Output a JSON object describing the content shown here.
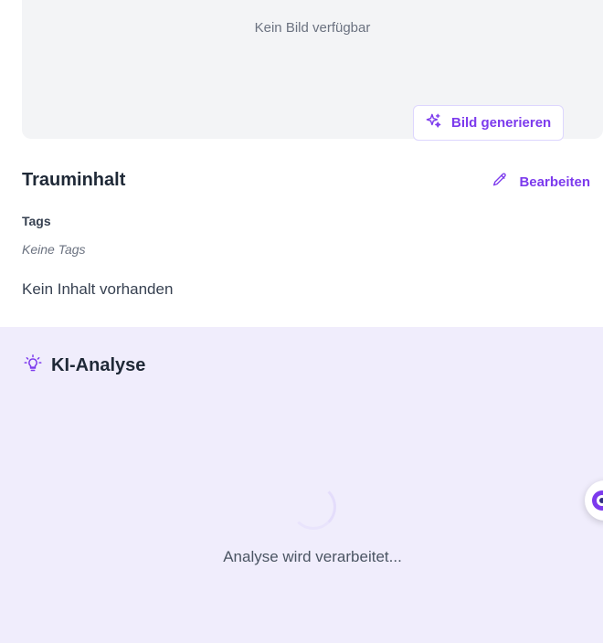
{
  "image_card": {
    "placeholder_text": "Kein Bild verfügbar",
    "generate_button_label": "Bild generieren"
  },
  "content": {
    "title": "Trauminhalt",
    "edit_label": "Bearbeiten",
    "tags_label": "Tags",
    "tags_empty": "Keine Tags",
    "body_text": "Kein Inhalt vorhanden"
  },
  "ai_analysis": {
    "title": "KI-Analyse",
    "status_text": "Analyse wird verarbeitet..."
  },
  "icons": {
    "generate": "sparkles-icon",
    "edit": "pencil-icon",
    "ai": "lightbulb-icon",
    "assistant": "assistant-icon"
  },
  "colors": {
    "accent": "#7c3aed",
    "ai_background": "#f0edfc",
    "image_card_background": "#f3f4f6"
  }
}
